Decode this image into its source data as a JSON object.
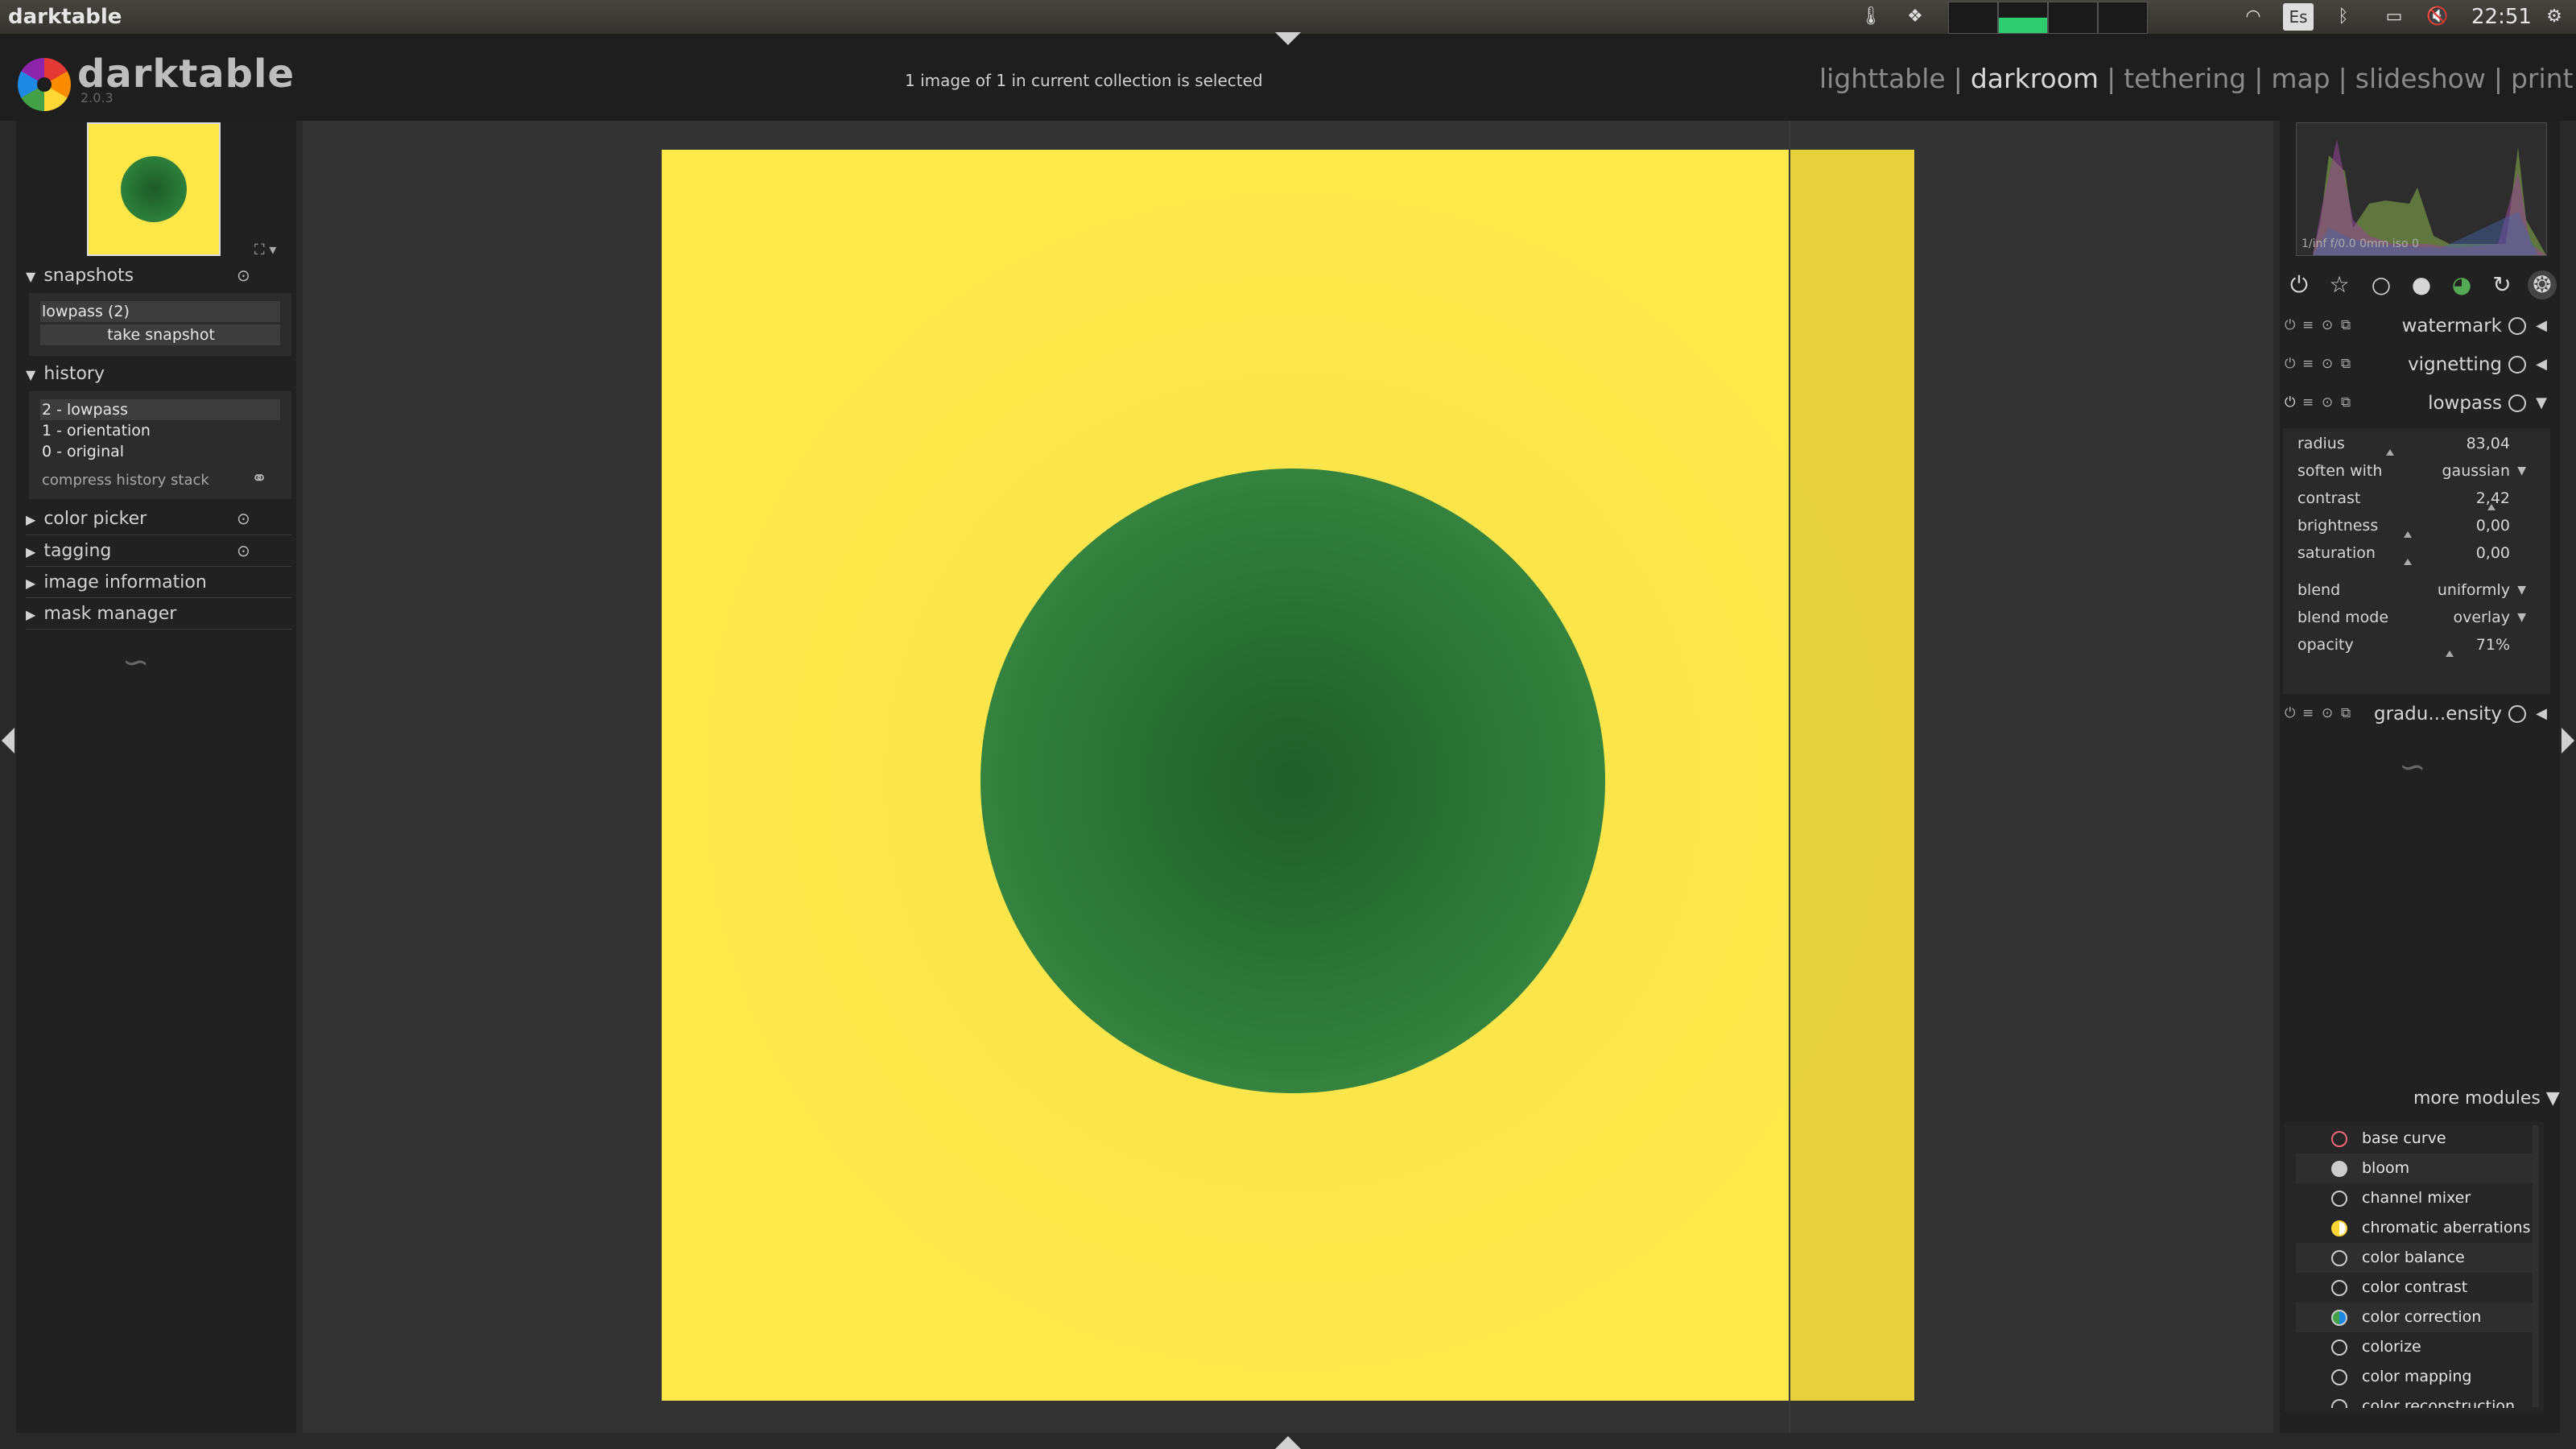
{
  "system": {
    "app_title": "darktable",
    "keyboard": "Es",
    "clock": "22:51"
  },
  "header": {
    "brand": "darktable",
    "version": "2.0.3",
    "selection_info": "1 image of 1 in current collection is selected",
    "views": [
      "lighttable",
      "darkroom",
      "tethering",
      "map",
      "slideshow",
      "print"
    ],
    "active_view": "darkroom",
    "separator": "|"
  },
  "left": {
    "snapshots": {
      "title": "snapshots",
      "items": [
        "lowpass (2)"
      ],
      "take_snapshot": "take snapshot"
    },
    "history": {
      "title": "history",
      "items": [
        "2 - lowpass",
        "1 - orientation",
        "0 - original"
      ],
      "compress": "compress history stack"
    },
    "sections": [
      "color picker",
      "tagging",
      "image information",
      "mask manager"
    ]
  },
  "histogram": {
    "exif": "1/inf f/0.0 0mm iso 0"
  },
  "modules": {
    "watermark": "watermark",
    "vignetting": "vignetting",
    "lowpass": "lowpass",
    "graduated": "gradu...ensity",
    "params": [
      {
        "label": "radius",
        "value": "83,04"
      },
      {
        "label": "soften with",
        "value": "gaussian"
      },
      {
        "label": "contrast",
        "value": "2,42"
      },
      {
        "label": "brightness",
        "value": "0,00"
      },
      {
        "label": "saturation",
        "value": "0,00"
      },
      {
        "label": "blend",
        "value": "uniformly"
      },
      {
        "label": "blend mode",
        "value": "overlay"
      },
      {
        "label": "opacity",
        "value": "71%"
      }
    ],
    "more_modules": "more modules",
    "list": [
      "base curve",
      "bloom",
      "channel mixer",
      "chromatic aberrations",
      "color balance",
      "color contrast",
      "color correction",
      "colorize",
      "color mapping",
      "color reconstruction"
    ]
  },
  "colors": {
    "canvas_yellow": "#fce648",
    "circle_green": "#2a7a38",
    "panel_bg": "#212121"
  }
}
